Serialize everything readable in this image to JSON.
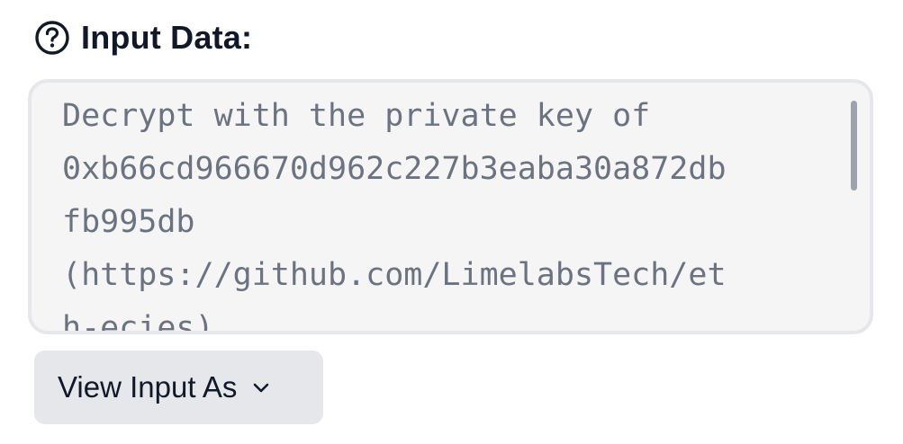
{
  "field": {
    "label": "Input Data:",
    "help_icon": "question-circle-icon"
  },
  "input": {
    "lines": [
      "Decrypt with the private key of",
      "0xb66cd966670d962c227b3eaba30a872db",
      "fb995db",
      "(https://github.com/LimelabsTech/et",
      "h-ecies)"
    ]
  },
  "view_button": {
    "label": "View Input As",
    "icon": "chevron-down-icon"
  },
  "colors": {
    "text": "#111827",
    "muted_text": "#6b7280",
    "textarea_bg": "#f5f5f5",
    "border": "#e5e7eb",
    "button_bg": "#e5e7eb"
  }
}
